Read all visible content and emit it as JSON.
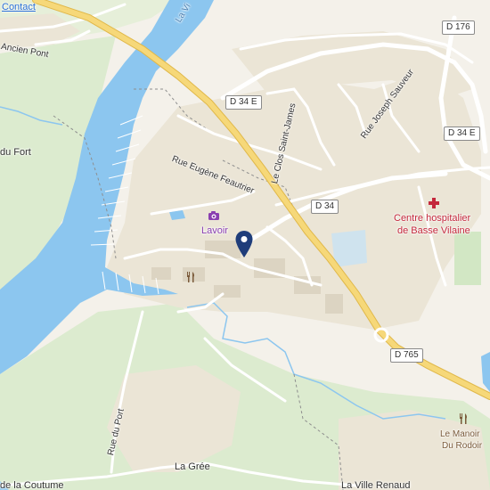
{
  "header": {
    "contact_link": "Contact"
  },
  "roads": {
    "d176": "D 176",
    "d34e_top": "D 34 E",
    "d34e_right": "D 34 E",
    "d34": "D 34",
    "d765": "D 765"
  },
  "streets": {
    "ancien_pont": "Ancien Pont",
    "la_vilaine": "La Vi",
    "du_fort": "du Fort",
    "rue_eugene": "Rue Eugène Feautrier",
    "clos_saint_james": "Le Clos Saint-James",
    "rue_joseph": "Rue Joseph Sauveur",
    "rue_du_port": "Rue du Port",
    "la_coutume": "de la Coutume",
    "la_gree": "La Grée",
    "la_ville_renaud": "La Ville Renaud"
  },
  "pois": {
    "lavoir": "Lavoir",
    "hospital_line1": "Centre hospitalier",
    "hospital_line2": "de Basse Vilaine",
    "manoir_line1": "Le Manoir",
    "manoir_line2": "Du Rodoir"
  },
  "icons": {
    "lavoir": "camera-icon",
    "hospital": "red-cross-icon",
    "restaurant_west": "fork-knife-icon",
    "restaurant_east": "fork-knife-icon",
    "location_pin": "map-pin-icon"
  },
  "colors": {
    "water": "#8cc6ef",
    "land": "#f4f1ea",
    "green": "#dcebcf",
    "urban": "#ebe5d6",
    "major_road": "#f6d879",
    "pin": "#1f3d7a",
    "poi_purple": "#8a3fb0",
    "poi_red": "#c4283c"
  }
}
